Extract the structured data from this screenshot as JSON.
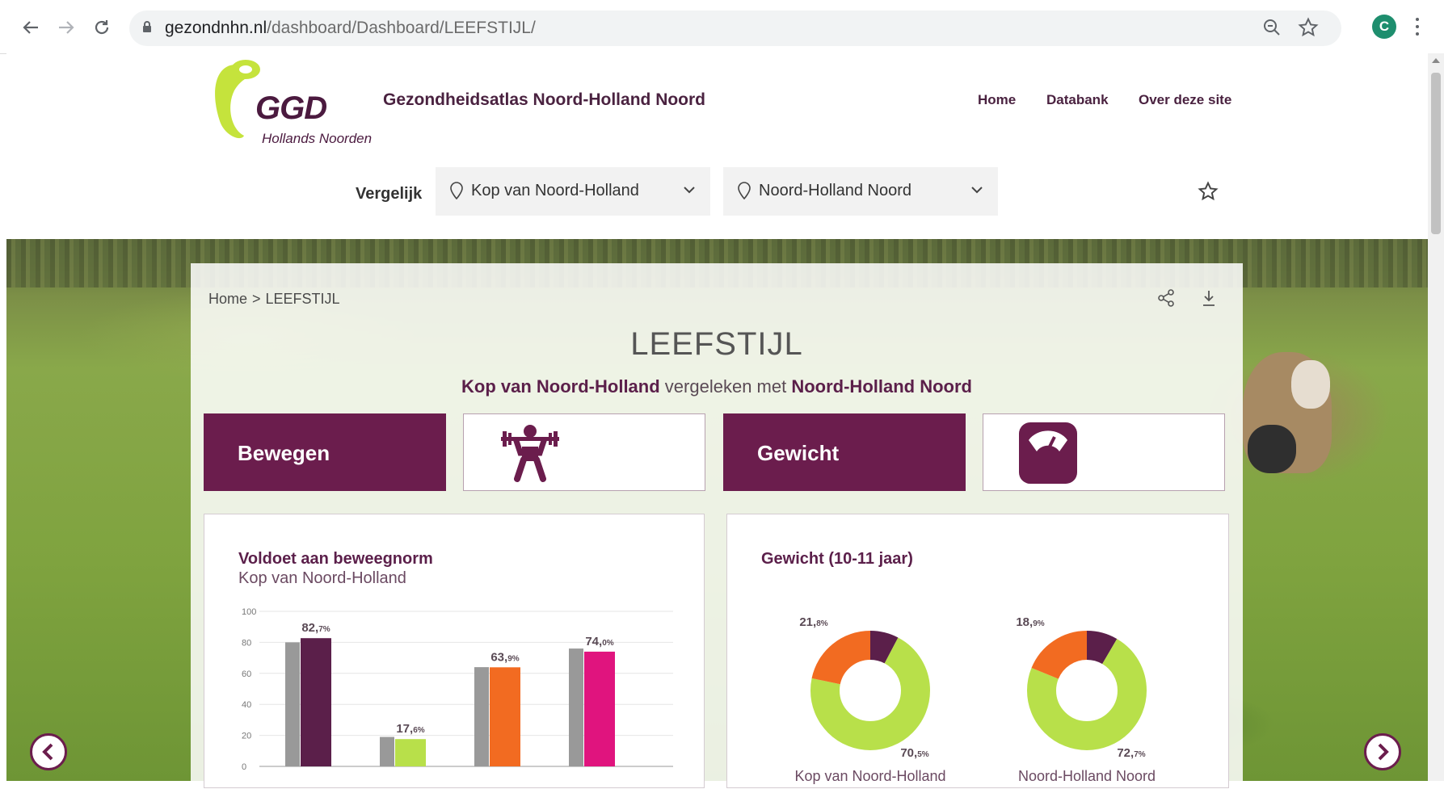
{
  "browser": {
    "url_host": "gezondnhn.nl",
    "url_path": "/dashboard/Dashboard/LEEFSTIJL/",
    "profile_initial": "C"
  },
  "header": {
    "logo_text": "GGD",
    "logo_sub": "Hollands Noorden",
    "site_title": "Gezondheidsatlas Noord-Holland Noord",
    "nav": [
      "Home",
      "Databank",
      "Over deze site"
    ]
  },
  "compare": {
    "label": "Vergelijk",
    "region_a": "Kop van Noord-Holland",
    "region_b": "Noord-Holland Noord"
  },
  "breadcrumb": {
    "home": "Home",
    "sep": ">",
    "current": "LEEFSTIJL"
  },
  "page": {
    "title": "LEEFSTIJL",
    "subtitle_a": "Kop van Noord-Holland",
    "subtitle_mid": "vergeleken met",
    "subtitle_b": "Noord-Holland Noord"
  },
  "tiles": {
    "bewegen": "Bewegen",
    "gewicht": "Gewicht"
  },
  "colors": {
    "brand": "#6b1d4d",
    "bar_compare": "#999999",
    "bars": [
      "#5b1f4a",
      "#b8e04a",
      "#f26b21",
      "#e0147e"
    ],
    "donut": [
      "#b8e04a",
      "#f26b21",
      "#5b1f4a"
    ]
  },
  "chart_data": [
    {
      "type": "bar",
      "title": "Voldoet aan beweegnorm",
      "subtitle": "Kop van Noord-Holland",
      "ylim": [
        0,
        100
      ],
      "yticks": [
        0,
        20,
        40,
        60,
        80,
        100
      ],
      "grid": true,
      "groups": 4,
      "series": [
        {
          "values": [
            80,
            19,
            64,
            76
          ]
        },
        {
          "values": [
            82.7,
            17.6,
            63.9,
            74.0
          ]
        }
      ],
      "labels": [
        {
          "main": "82,",
          "dec": "7%"
        },
        {
          "main": "17,",
          "dec": "6%"
        },
        {
          "main": "63,",
          "dec": "9%"
        },
        {
          "main": "74,",
          "dec": "0%"
        }
      ]
    },
    {
      "type": "pie",
      "title": "Gewicht (10-11 jaar)",
      "donuts": [
        {
          "name": "Kop van Noord-Holland",
          "values": [
            70.5,
            21.8,
            7.7
          ],
          "label_top": {
            "main": "21,",
            "dec": "8%"
          },
          "label_bottom": {
            "main": "70,",
            "dec": "5%"
          }
        },
        {
          "name": "Noord-Holland Noord",
          "values": [
            72.7,
            18.9,
            8.4
          ],
          "label_top": {
            "main": "18,",
            "dec": "9%"
          },
          "label_bottom": {
            "main": "72,",
            "dec": "7%"
          }
        }
      ]
    }
  ]
}
